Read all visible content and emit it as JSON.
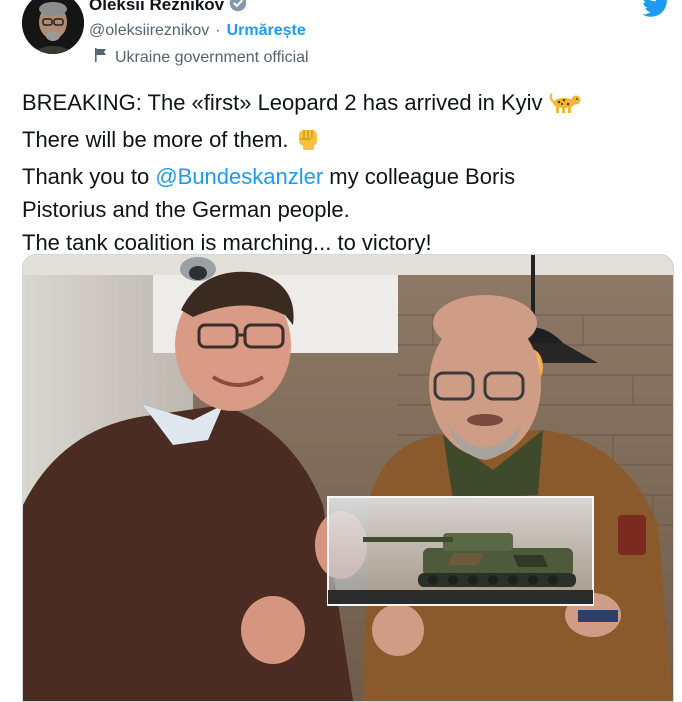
{
  "author": {
    "name": "Oleksii Reznikov",
    "handle": "@oleksiireznikov",
    "separator": "·",
    "follow_label": "Urmărește",
    "label": "Ukraine government official"
  },
  "icons": {
    "verified": "verified-badge-icon",
    "flag": "flag-icon",
    "platform": "twitter-bird-icon",
    "emoji_1": "leopard-emoji",
    "emoji_2": "raised-fist-emoji"
  },
  "tweet": {
    "line1": "BREAKING: The «first» Leopard 2 has arrived in Kyiv",
    "line2": "There will be more of them.",
    "line3_pre": "Thank you to ",
    "line3_mention": "@Bundeskanzler",
    "line3_post": " my colleague Boris",
    "line4": "Pistorius and the German people.",
    "line5": "The tank coalition is marching... to victory!"
  },
  "colors": {
    "accent": "#1d9bf0",
    "text": "#0f1419",
    "secondary": "#536471",
    "verified": "#829aab"
  }
}
